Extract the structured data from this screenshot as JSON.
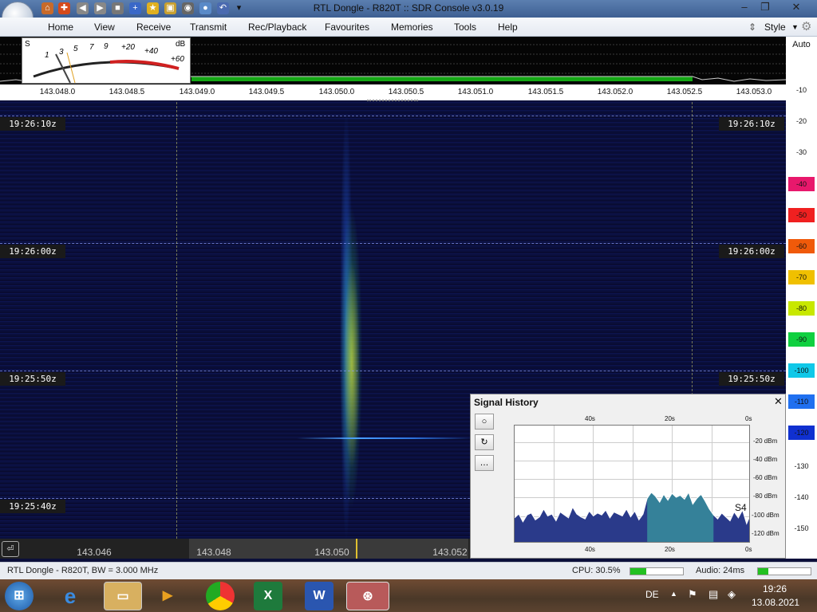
{
  "window": {
    "title": "RTL Dongle - R820T :: SDR Console v3.0.19"
  },
  "menubar": {
    "items": [
      "Home",
      "View",
      "Receive",
      "Transmit",
      "Rec/Playback",
      "Favourites",
      "Memories",
      "Tools",
      "Help"
    ],
    "style_label": "Style"
  },
  "meter": {
    "scale_s": [
      "S",
      "1",
      "3",
      "5",
      "7",
      "9",
      "+20",
      "+40",
      "+60"
    ],
    "unit": "dB"
  },
  "freq_axis": [
    "143.048.0",
    "143.048.5",
    "143.049.0",
    "143.049.5",
    "143.050.0",
    "143.050.5",
    "143.051.0",
    "143.051.5",
    "143.052.0",
    "143.052.5",
    "143.053.0"
  ],
  "colorbar": {
    "auto_label": "Auto",
    "plain_levels": [
      "-10",
      "-20",
      "-30"
    ],
    "color_levels": [
      {
        "label": "-40",
        "color": "#e8186c"
      },
      {
        "label": "-50",
        "color": "#f02020"
      },
      {
        "label": "-60",
        "color": "#f05a0a"
      },
      {
        "label": "-70",
        "color": "#f0c000"
      },
      {
        "label": "-80",
        "color": "#c8e800"
      },
      {
        "label": "-90",
        "color": "#10d040"
      },
      {
        "label": "-100",
        "color": "#10c8e8"
      },
      {
        "label": "-110",
        "color": "#2070f0"
      },
      {
        "label": "-120",
        "color": "#1030d0"
      }
    ],
    "lower_levels": [
      "-130",
      "-140",
      "-150"
    ]
  },
  "waterfall": {
    "times": [
      "19:26:10z",
      "19:26:00z",
      "19:25:50z",
      "19:25:40z"
    ]
  },
  "bottom_scale": [
    "143.046",
    "143.048",
    "143.050",
    "143.052"
  ],
  "signal_history": {
    "title": "Signal History",
    "time_labels": [
      "40s",
      "20s",
      "0s"
    ],
    "dbm_labels": [
      "-20 dBm",
      "-40 dBm",
      "-60 dBm",
      "-80 dBm",
      "-100 dBm",
      "-120 dBm"
    ],
    "s_label": "S4",
    "history_dbm": [
      -104,
      -100,
      -108,
      -101,
      -99,
      -106,
      -103,
      -95,
      -102,
      -100,
      -107,
      -98,
      -101,
      -104,
      -93,
      -100,
      -103,
      -105,
      -97,
      -102,
      -99,
      -101,
      -96,
      -104,
      -98,
      -100,
      -102,
      -95,
      -103,
      -97,
      -106,
      -100,
      -84,
      -78,
      -82,
      -88,
      -80,
      -86,
      -79,
      -83,
      -81,
      -85,
      -78,
      -90,
      -84,
      -80,
      -87,
      -95,
      -101,
      -105,
      -99,
      -103,
      -107,
      -98,
      -104,
      -96,
      -110,
      -100
    ]
  },
  "status": {
    "left": "RTL Dongle - R820T, BW = 3.000 MHz",
    "cpu": "CPU: 30.5%",
    "cpu_level": 0.3,
    "audio": "Audio: 24ms",
    "audio_level": 0.2
  },
  "taskbar": {
    "lang": "DE",
    "time": "19:26",
    "date": "13.08.2021"
  }
}
